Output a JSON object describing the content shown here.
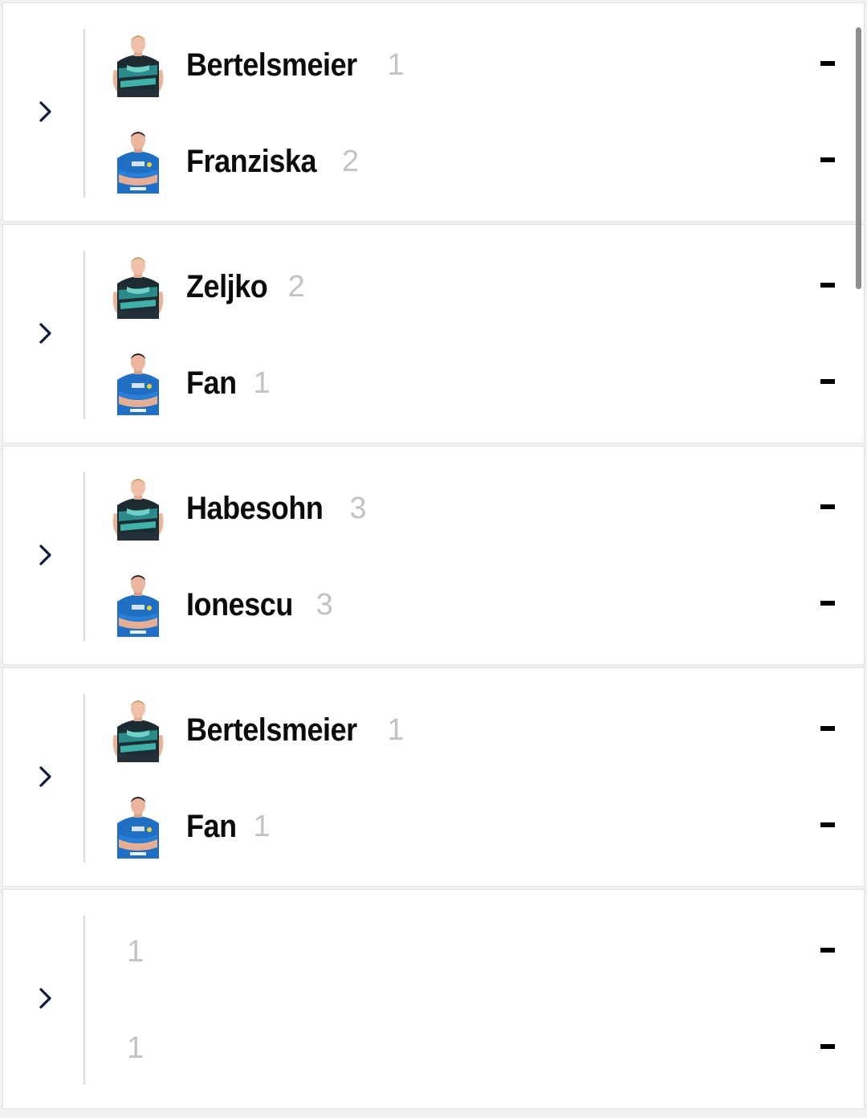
{
  "matches": [
    {
      "players": [
        {
          "name": "Bertelsmeier",
          "number": "1",
          "score": "-",
          "avatar": "player-photo-striped-jersey"
        },
        {
          "name": "Franziska",
          "number": "2",
          "score": "-",
          "avatar": "player-photo-blue-jersey"
        }
      ]
    },
    {
      "players": [
        {
          "name": "Zeljko",
          "number": "2",
          "score": "-",
          "avatar": "player-photo-striped-jersey"
        },
        {
          "name": "Fan",
          "number": "1",
          "score": "-",
          "avatar": "player-photo-blue-jersey"
        }
      ]
    },
    {
      "players": [
        {
          "name": "Habesohn",
          "number": "3",
          "score": "-",
          "avatar": "player-photo-striped-jersey"
        },
        {
          "name": "Ionescu",
          "number": "3",
          "score": "-",
          "avatar": "player-photo-blue-jersey"
        }
      ]
    },
    {
      "players": [
        {
          "name": "Bertelsmeier",
          "number": "1",
          "score": "-",
          "avatar": "player-photo-striped-jersey"
        },
        {
          "name": "Fan",
          "number": "1",
          "score": "-",
          "avatar": "player-photo-blue-jersey"
        }
      ]
    },
    {
      "players": [
        {
          "name": "",
          "number": "1",
          "score": "-",
          "avatar": ""
        },
        {
          "name": "",
          "number": "1",
          "score": "-",
          "avatar": ""
        }
      ]
    }
  ],
  "colors": {
    "chevron": "#0d1b3e",
    "name": "#0b0b0b",
    "number": "#c3c3c6",
    "divider": "#d9d9dc",
    "jersey_blue": "#1f6fc4",
    "jersey_teal": "#2b8a8a",
    "jersey_dark": "#1d2b33"
  }
}
